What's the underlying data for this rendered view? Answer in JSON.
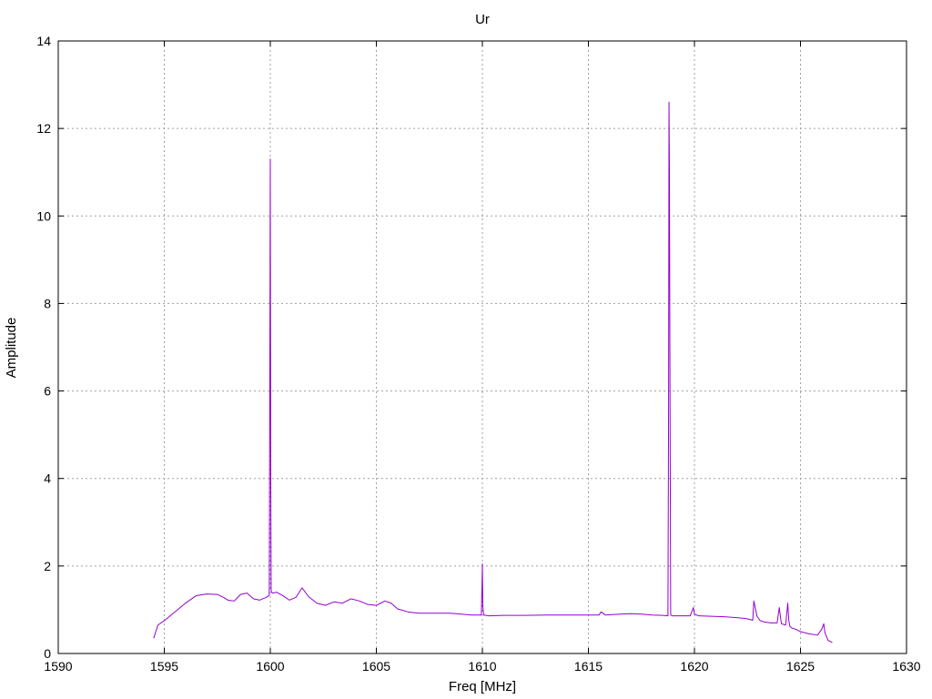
{
  "chart_data": {
    "type": "line",
    "title": "Ur",
    "xlabel": "Freq [MHz]",
    "ylabel": "Amplitude",
    "xlim": [
      1590,
      1630
    ],
    "ylim": [
      0,
      14
    ],
    "x_ticks": [
      1590,
      1595,
      1600,
      1605,
      1610,
      1615,
      1620,
      1625,
      1630
    ],
    "y_ticks": [
      0,
      2,
      4,
      6,
      8,
      10,
      12,
      14
    ],
    "grid": true,
    "legend": "none",
    "series": [
      {
        "color": "#9400d3",
        "x": [
          1594.5,
          1594.7,
          1595.0,
          1595.5,
          1596.0,
          1596.5,
          1597.0,
          1597.5,
          1597.8,
          1598.0,
          1598.3,
          1598.6,
          1598.9,
          1599.2,
          1599.5,
          1599.8,
          1599.95,
          1599.98,
          1600.0,
          1600.02,
          1600.04,
          1600.06,
          1600.1,
          1600.3,
          1600.6,
          1600.9,
          1601.2,
          1601.5,
          1601.8,
          1602.2,
          1602.6,
          1603.0,
          1603.4,
          1603.8,
          1604.2,
          1604.6,
          1605.0,
          1605.4,
          1605.7,
          1606.0,
          1606.5,
          1607.0,
          1607.5,
          1608.0,
          1608.5,
          1609.0,
          1609.5,
          1609.95,
          1609.98,
          1610.0,
          1610.02,
          1610.06,
          1610.3,
          1611.0,
          1612.0,
          1613.0,
          1614.0,
          1615.0,
          1615.5,
          1615.6,
          1615.8,
          1616.5,
          1617.0,
          1617.5,
          1618.0,
          1618.5,
          1618.75,
          1618.78,
          1618.8,
          1618.82,
          1618.84,
          1618.88,
          1618.95,
          1619.3,
          1619.8,
          1619.95,
          1620.0,
          1620.2,
          1620.8,
          1621.4,
          1622.0,
          1622.4,
          1622.6,
          1622.75,
          1622.8,
          1622.95,
          1623.1,
          1623.3,
          1623.6,
          1623.9,
          1624.0,
          1624.1,
          1624.3,
          1624.4,
          1624.45,
          1624.5,
          1624.6,
          1624.8,
          1625.0,
          1625.4,
          1625.8,
          1626.0,
          1626.1,
          1626.15,
          1626.2,
          1626.3,
          1626.5
        ],
        "y": [
          0.35,
          0.65,
          0.75,
          0.95,
          1.15,
          1.32,
          1.36,
          1.35,
          1.28,
          1.22,
          1.2,
          1.35,
          1.38,
          1.25,
          1.22,
          1.28,
          1.33,
          7.0,
          11.3,
          4.2,
          1.45,
          1.4,
          1.38,
          1.4,
          1.32,
          1.22,
          1.28,
          1.5,
          1.3,
          1.15,
          1.1,
          1.18,
          1.15,
          1.25,
          1.2,
          1.12,
          1.1,
          1.2,
          1.15,
          1.02,
          0.95,
          0.92,
          0.92,
          0.92,
          0.92,
          0.9,
          0.88,
          0.88,
          1.5,
          2.05,
          1.1,
          0.88,
          0.86,
          0.87,
          0.87,
          0.88,
          0.88,
          0.88,
          0.88,
          0.95,
          0.88,
          0.9,
          0.91,
          0.9,
          0.88,
          0.87,
          0.86,
          5.5,
          12.6,
          11.0,
          7.3,
          0.88,
          0.86,
          0.86,
          0.86,
          1.05,
          0.9,
          0.86,
          0.85,
          0.84,
          0.82,
          0.8,
          0.78,
          0.76,
          1.2,
          0.85,
          0.75,
          0.72,
          0.7,
          0.7,
          1.05,
          0.68,
          0.65,
          1.15,
          0.75,
          0.62,
          0.58,
          0.55,
          0.5,
          0.45,
          0.42,
          0.55,
          0.68,
          0.48,
          0.42,
          0.3,
          0.25
        ]
      }
    ]
  }
}
